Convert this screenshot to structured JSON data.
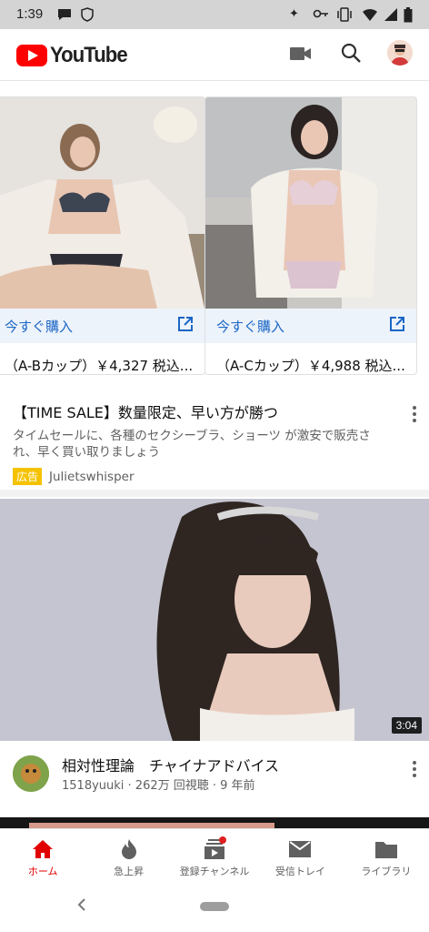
{
  "status": {
    "time": "1:39"
  },
  "header": {
    "logo_text": "YouTube"
  },
  "ad": {
    "cards": [
      {
        "cta": "今すぐ購入",
        "caption": "（A-Bカップ）￥4,327 税込..."
      },
      {
        "cta": "今すぐ購入",
        "caption": "（A-Cカップ）￥4,988 税込..."
      }
    ],
    "title": "【TIME SALE】数量限定、早い方が勝つ",
    "description": "タイムセールに、各種のセクシーブラ、ショーツ が激安で販売され、早く買い取りましょう",
    "badge": "広告",
    "advertiser": "Julietswhisper"
  },
  "video": {
    "duration": "3:04",
    "title": "相対性理論　チャイナアドバイス",
    "meta": "1518yuuki · 262万 回視聴 · 9 年前"
  },
  "tabs": [
    {
      "label": "ホーム",
      "icon": "home-icon"
    },
    {
      "label": "急上昇",
      "icon": "flame-icon"
    },
    {
      "label": "登録チャンネル",
      "icon": "subscriptions-icon"
    },
    {
      "label": "受信トレイ",
      "icon": "mail-icon"
    },
    {
      "label": "ライブラリ",
      "icon": "folder-icon"
    }
  ],
  "colors": {
    "brand": "#ff0000",
    "link": "#1a66c5",
    "ad_badge": "#f5c200"
  }
}
